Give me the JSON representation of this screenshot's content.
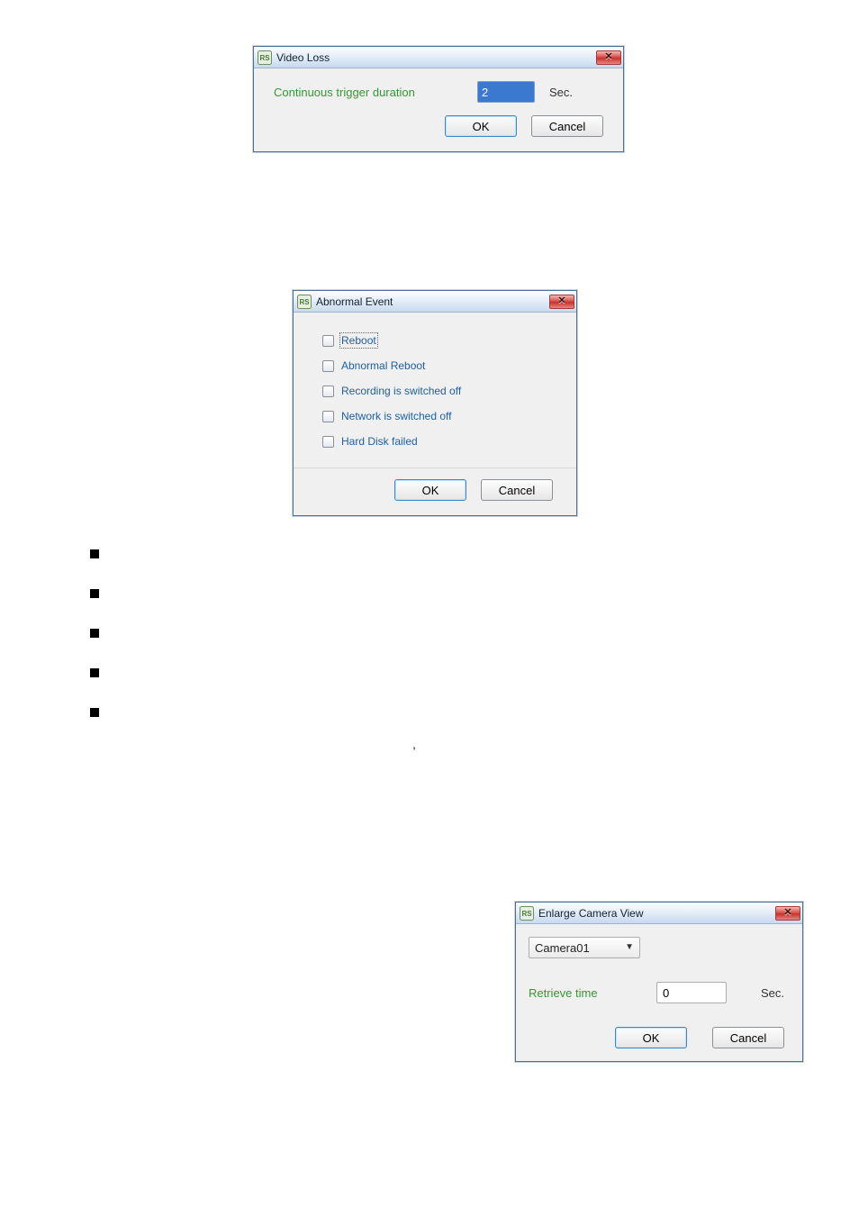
{
  "dialog1": {
    "title": "Video Loss",
    "label": "Continuous trigger duration",
    "value": "2",
    "unit": "Sec.",
    "ok": "OK",
    "cancel": "Cancel"
  },
  "dialog2": {
    "title": "Abnormal Event",
    "items": [
      {
        "label": "Reboot"
      },
      {
        "label": "Abnormal Reboot"
      },
      {
        "label": "Recording is switched off"
      },
      {
        "label": "Network is switched off"
      },
      {
        "label": "Hard Disk failed"
      }
    ],
    "ok": "OK",
    "cancel": "Cancel"
  },
  "dialog3": {
    "title": "Enlarge Camera View",
    "camera": "Camera01",
    "retrieve_label": "Retrieve time",
    "retrieve_value": "0",
    "unit": "Sec.",
    "ok": "OK",
    "cancel": "Cancel"
  }
}
